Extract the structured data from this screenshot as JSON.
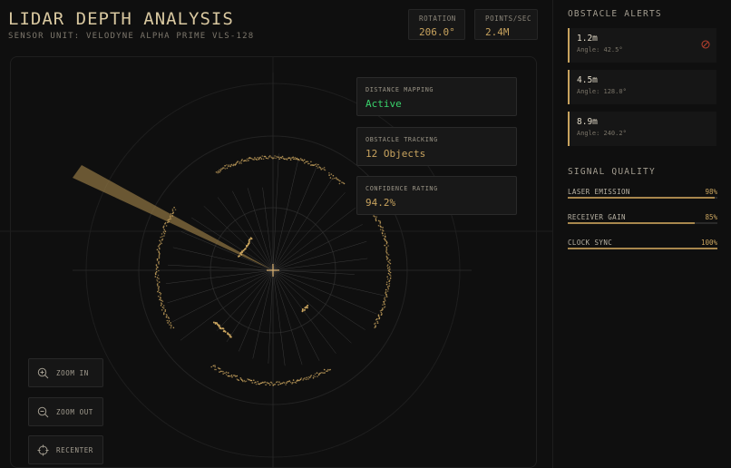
{
  "header": {
    "title": "LIDAR DEPTH ANALYSIS",
    "subtitle": "SENSOR UNIT: VELODYNE ALPHA PRIME VLS-128"
  },
  "stats": [
    {
      "label": "ROTATION",
      "value": "206.0°"
    },
    {
      "label": "POINTS/SEC",
      "value": "2.4M"
    }
  ],
  "status_cards": [
    {
      "label": "DISTANCE MAPPING",
      "value": "Active"
    },
    {
      "label": "OBSTACLE TRACKING",
      "value": "12 Objects"
    },
    {
      "label": "CONFIDENCE RATING",
      "value": "94.2%"
    }
  ],
  "controls": [
    {
      "label": "ZOOM IN",
      "icon": "zoom-in-icon"
    },
    {
      "label": "ZOOM OUT",
      "icon": "zoom-out-icon"
    },
    {
      "label": "RECENTER",
      "icon": "crosshair-icon"
    }
  ],
  "alerts_title": "OBSTACLE ALERTS",
  "alerts": [
    {
      "distance": "1.2m",
      "angle": "Angle: 42.5°",
      "warning": true
    },
    {
      "distance": "4.5m",
      "angle": "Angle: 128.0°",
      "warning": false
    },
    {
      "distance": "8.9m",
      "angle": "Angle: 240.2°",
      "warning": false
    }
  ],
  "signal_title": "SIGNAL QUALITY",
  "signal": [
    {
      "label": "LASER EMISSION",
      "pct": "98%",
      "level": 0.98
    },
    {
      "label": "RECEIVER GAIN",
      "pct": "85%",
      "level": 0.85
    },
    {
      "label": "CLOCK SYNC",
      "pct": "100%",
      "level": 1.0
    }
  ],
  "colors": {
    "accent": "#c8a35e",
    "active": "#39d16b",
    "warning": "#b8402e",
    "background": "#0f0f0f"
  }
}
